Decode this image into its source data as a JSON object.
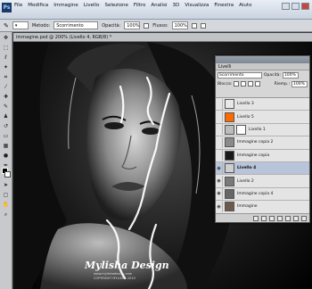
{
  "app": {
    "logo": "Ps"
  },
  "menu": [
    "File",
    "Modifica",
    "Immagine",
    "Livello",
    "Selezione",
    "Filtro",
    "Analisi",
    "3D",
    "Visualizza",
    "Finestra",
    "Aiuto"
  ],
  "options": {
    "method_label": "Metodo:",
    "method_value": "Scorrimento",
    "opacity_label": "Opacità:",
    "opacity_value": "100%",
    "flow_label": "Flusso:",
    "flow_value": "100%"
  },
  "document": {
    "tab": "immagine.psd @ 200% (Livello 4, RGB/8) *"
  },
  "watermark": {
    "title": "Mylisha Design",
    "line1": "www.mylishadesign.com",
    "line2": "COPYRIGHT MYLISHA 2010"
  },
  "layers_panel": {
    "title": "Livelli",
    "blend_mode": "Scorrimento",
    "opacity_label": "Opacità:",
    "opacity_value": "100%",
    "lock_label": "Blocca:",
    "fill_label": "Riemp.:",
    "fill_value": "100%",
    "layers": [
      {
        "name": "Livello 3",
        "thumb": "#e8e8e8",
        "mask": false,
        "selected": false,
        "visible": false
      },
      {
        "name": "Livello 5",
        "thumb": "#ff6a00",
        "mask": false,
        "selected": false,
        "visible": false
      },
      {
        "name": "Livello 1",
        "thumb": "#bdbdbd",
        "mask": true,
        "selected": false,
        "visible": false
      },
      {
        "name": "Immagine copia 2",
        "thumb": "#8a8a8a",
        "mask": false,
        "selected": false,
        "visible": false
      },
      {
        "name": "Immagine copia",
        "thumb": "#1a1a1a",
        "mask": false,
        "selected": false,
        "visible": false
      },
      {
        "name": "Livello 4",
        "thumb": "#cfcfcf",
        "mask": false,
        "selected": true,
        "visible": true
      },
      {
        "name": "Livello 2",
        "thumb": "#7a7a7a",
        "mask": false,
        "selected": false,
        "visible": true
      },
      {
        "name": "Immagine copia 4",
        "thumb": "#666666",
        "mask": false,
        "selected": false,
        "visible": true
      },
      {
        "name": "Immagine",
        "thumb": "#6d5a4d",
        "mask": false,
        "selected": false,
        "visible": true
      }
    ]
  }
}
